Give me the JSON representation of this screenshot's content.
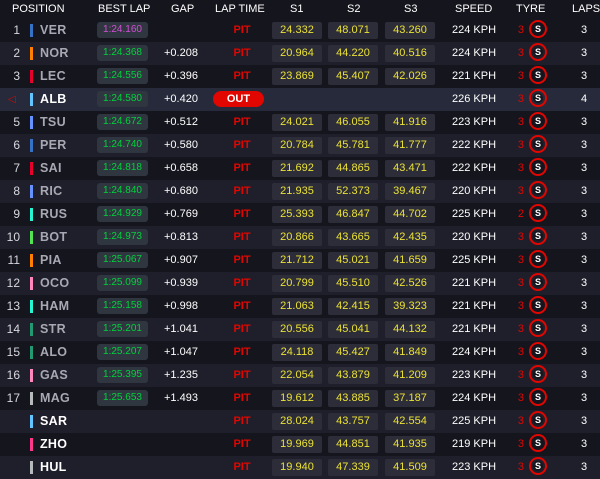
{
  "headers": {
    "position": "POSITION",
    "best_lap": "BEST LAP",
    "gap": "GAP",
    "lap_time": "LAP TIME",
    "s1": "S1",
    "s2": "S2",
    "s3": "S3",
    "speed": "SPEED",
    "tyre": "TYRE",
    "laps": "LAPS"
  },
  "tyre_letter": "S",
  "colors": {
    "background": "#15151e",
    "row_alt": "#1f1f2b",
    "pit": "#e10600",
    "sector_yellow": "#ebe233",
    "personal_best": "#00d23c",
    "fastest_lap": "#d34fd5"
  },
  "rows": [
    {
      "pos": "1",
      "driver": "VER",
      "team_color": "#3671c6",
      "best_lap": "1:24.160",
      "fastest": true,
      "gap": "",
      "status": "PIT",
      "s1": "24.332",
      "s2": "48.071",
      "s3": "43.260",
      "speed": "224 KPH",
      "tyre_age": "3",
      "laps": "3"
    },
    {
      "pos": "2",
      "driver": "NOR",
      "team_color": "#ff8000",
      "best_lap": "1:24.368",
      "fastest": false,
      "gap": "+0.208",
      "status": "PIT",
      "s1": "20.964",
      "s2": "44.220",
      "s3": "40.516",
      "speed": "224 KPH",
      "tyre_age": "3",
      "laps": "3"
    },
    {
      "pos": "3",
      "driver": "LEC",
      "team_color": "#e8002d",
      "best_lap": "1:24.556",
      "fastest": false,
      "gap": "+0.396",
      "status": "PIT",
      "s1": "23.869",
      "s2": "45.407",
      "s3": "42.026",
      "speed": "221 KPH",
      "tyre_age": "3",
      "laps": "3"
    },
    {
      "pos": "",
      "driver": "ALB",
      "team_color": "#64c4ff",
      "best_lap": "1:24.580",
      "fastest": false,
      "gap": "+0.420",
      "status": "OUT",
      "s1": "",
      "s2": "",
      "s3": "",
      "speed": "226 KPH",
      "tyre_age": "3",
      "laps": "4"
    },
    {
      "pos": "5",
      "driver": "TSU",
      "team_color": "#6692ff",
      "best_lap": "1:24.672",
      "fastest": false,
      "gap": "+0.512",
      "status": "PIT",
      "s1": "24.021",
      "s2": "46.055",
      "s3": "41.916",
      "speed": "223 KPH",
      "tyre_age": "3",
      "laps": "3"
    },
    {
      "pos": "6",
      "driver": "PER",
      "team_color": "#3671c6",
      "best_lap": "1:24.740",
      "fastest": false,
      "gap": "+0.580",
      "status": "PIT",
      "s1": "20.784",
      "s2": "45.781",
      "s3": "41.777",
      "speed": "222 KPH",
      "tyre_age": "3",
      "laps": "3"
    },
    {
      "pos": "7",
      "driver": "SAI",
      "team_color": "#e8002d",
      "best_lap": "1:24.818",
      "fastest": false,
      "gap": "+0.658",
      "status": "PIT",
      "s1": "21.692",
      "s2": "44.865",
      "s3": "43.471",
      "speed": "222 KPH",
      "tyre_age": "3",
      "laps": "3"
    },
    {
      "pos": "8",
      "driver": "RIC",
      "team_color": "#6692ff",
      "best_lap": "1:24.840",
      "fastest": false,
      "gap": "+0.680",
      "status": "PIT",
      "s1": "21.935",
      "s2": "52.373",
      "s3": "39.467",
      "speed": "220 KPH",
      "tyre_age": "3",
      "laps": "3"
    },
    {
      "pos": "9",
      "driver": "RUS",
      "team_color": "#27f4d2",
      "best_lap": "1:24.929",
      "fastest": false,
      "gap": "+0.769",
      "status": "PIT",
      "s1": "25.393",
      "s2": "46.847",
      "s3": "44.702",
      "speed": "225 KPH",
      "tyre_age": "2",
      "laps": "3"
    },
    {
      "pos": "10",
      "driver": "BOT",
      "team_color": "#52e252",
      "best_lap": "1:24.973",
      "fastest": false,
      "gap": "+0.813",
      "status": "PIT",
      "s1": "20.866",
      "s2": "43.665",
      "s3": "42.435",
      "speed": "220 KPH",
      "tyre_age": "3",
      "laps": "3"
    },
    {
      "pos": "11",
      "driver": "PIA",
      "team_color": "#ff8000",
      "best_lap": "1:25.067",
      "fastest": false,
      "gap": "+0.907",
      "status": "PIT",
      "s1": "21.712",
      "s2": "45.021",
      "s3": "41.659",
      "speed": "225 KPH",
      "tyre_age": "3",
      "laps": "3"
    },
    {
      "pos": "12",
      "driver": "OCO",
      "team_color": "#ff87bc",
      "best_lap": "1:25.099",
      "fastest": false,
      "gap": "+0.939",
      "status": "PIT",
      "s1": "20.799",
      "s2": "45.510",
      "s3": "42.526",
      "speed": "221 KPH",
      "tyre_age": "3",
      "laps": "3"
    },
    {
      "pos": "13",
      "driver": "HAM",
      "team_color": "#27f4d2",
      "best_lap": "1:25.158",
      "fastest": false,
      "gap": "+0.998",
      "status": "PIT",
      "s1": "21.063",
      "s2": "42.415",
      "s3": "39.323",
      "speed": "221 KPH",
      "tyre_age": "3",
      "laps": "3"
    },
    {
      "pos": "14",
      "driver": "STR",
      "team_color": "#229971",
      "best_lap": "1:25.201",
      "fastest": false,
      "gap": "+1.041",
      "status": "PIT",
      "s1": "20.556",
      "s2": "45.041",
      "s3": "44.132",
      "speed": "221 KPH",
      "tyre_age": "3",
      "laps": "3"
    },
    {
      "pos": "15",
      "driver": "ALO",
      "team_color": "#229971",
      "best_lap": "1:25.207",
      "fastest": false,
      "gap": "+1.047",
      "status": "PIT",
      "s1": "24.118",
      "s2": "45.427",
      "s3": "41.849",
      "speed": "224 KPH",
      "tyre_age": "3",
      "laps": "3"
    },
    {
      "pos": "16",
      "driver": "GAS",
      "team_color": "#ff87bc",
      "best_lap": "1:25.395",
      "fastest": false,
      "gap": "+1.235",
      "status": "PIT",
      "s1": "22.054",
      "s2": "43.879",
      "s3": "41.209",
      "speed": "223 KPH",
      "tyre_age": "3",
      "laps": "3"
    },
    {
      "pos": "17",
      "driver": "MAG",
      "team_color": "#b6babd",
      "best_lap": "1:25.653",
      "fastest": false,
      "gap": "+1.493",
      "status": "PIT",
      "s1": "19.612",
      "s2": "43.885",
      "s3": "37.187",
      "speed": "224 KPH",
      "tyre_age": "3",
      "laps": "3"
    },
    {
      "pos": "",
      "driver": "SAR",
      "team_color": "#64c4ff",
      "best_lap": "",
      "fastest": false,
      "gap": "",
      "status": "PIT",
      "s1": "28.024",
      "s2": "43.757",
      "s3": "42.554",
      "speed": "225 KPH",
      "tyre_age": "3",
      "laps": "3"
    },
    {
      "pos": "",
      "driver": "ZHO",
      "team_color": "#ff3a8c",
      "best_lap": "",
      "fastest": false,
      "gap": "",
      "status": "PIT",
      "s1": "19.969",
      "s2": "44.851",
      "s3": "41.935",
      "speed": "219 KPH",
      "tyre_age": "3",
      "laps": "3"
    },
    {
      "pos": "",
      "driver": "HUL",
      "team_color": "#b6babd",
      "best_lap": "",
      "fastest": false,
      "gap": "",
      "status": "PIT",
      "s1": "19.940",
      "s2": "47.339",
      "s3": "41.509",
      "speed": "223 KPH",
      "tyre_age": "3",
      "laps": "3"
    }
  ]
}
